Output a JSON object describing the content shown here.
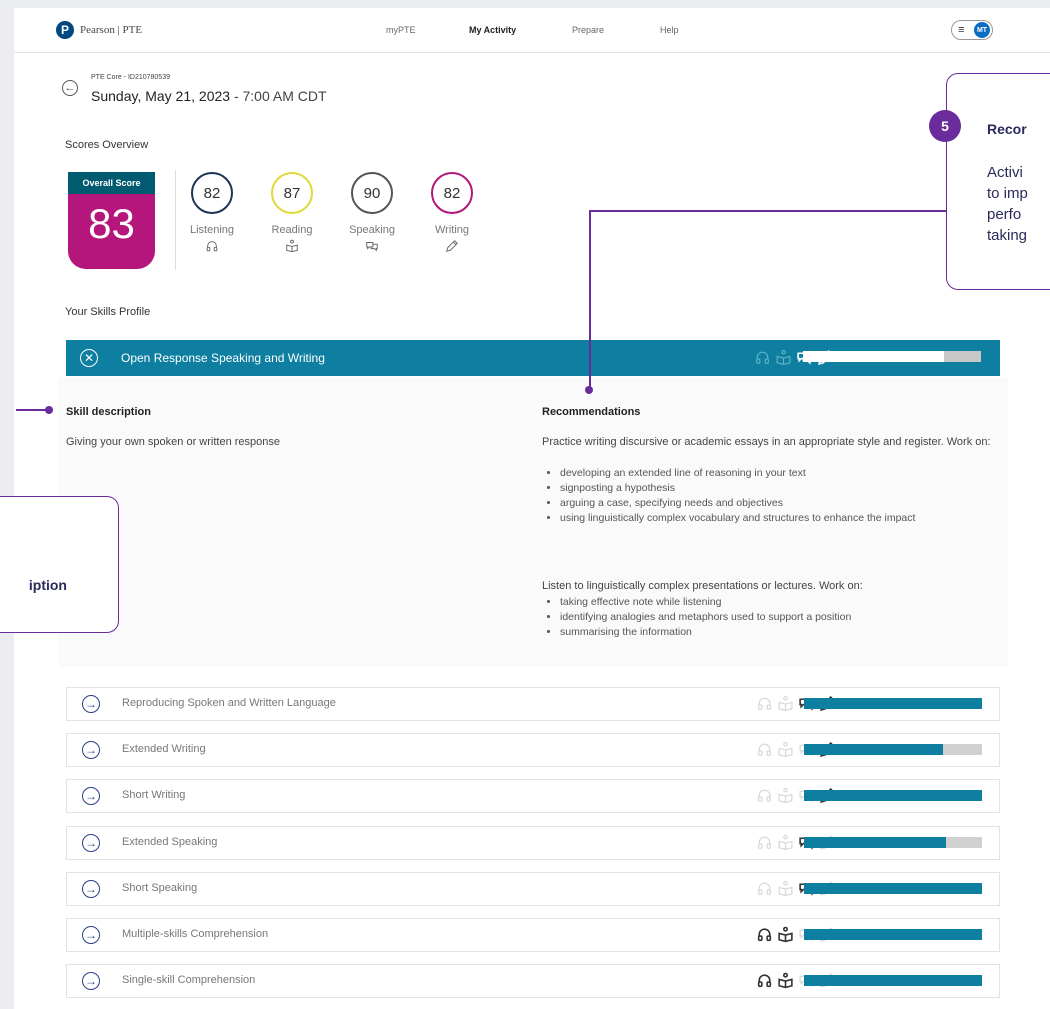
{
  "header": {
    "brand": "Pearson | PTE",
    "nav": [
      {
        "label": "myPTE",
        "active": false
      },
      {
        "label": "My Activity",
        "active": true
      },
      {
        "label": "Prepare",
        "active": false
      },
      {
        "label": "Help",
        "active": false
      }
    ],
    "menu_icon": "hamburger-icon",
    "avatar_initials": "MT"
  },
  "test": {
    "id_line": "PTE Core - ID210780539",
    "date": "Sunday, May 21, 2023",
    "time": " - 7:00 AM CDT"
  },
  "scores_overview": {
    "title": "Scores Overview",
    "overall_label": "Overall Score",
    "overall_value": "83",
    "overall_color": "#b5167c",
    "skills": [
      {
        "label": "Listening",
        "value": "82",
        "color": "#1d3557",
        "icon": "headphones-icon"
      },
      {
        "label": "Reading",
        "value": "87",
        "color": "#e1d83b",
        "icon": "book-icon"
      },
      {
        "label": "Speaking",
        "value": "90",
        "color": "#555555",
        "icon": "speech-bubbles-icon"
      },
      {
        "label": "Writing",
        "value": "82",
        "color": "#b5167c",
        "icon": "pen-icon"
      }
    ]
  },
  "skills_profile": {
    "title": "Your Skills Profile",
    "expanded": {
      "title": "Open Response Speaking and Writing",
      "progress": 0.79,
      "active_skills": [
        false,
        false,
        true,
        true
      ],
      "description_heading": "Skill description",
      "description": "Giving your own spoken or written response",
      "recommendations_heading": "Recommendations",
      "recommendation_groups": [
        {
          "intro": "Practice writing discursive or academic essays in an appropriate style and register. Work on:",
          "items": [
            "developing an extended line of reasoning in your text",
            "signposting a hypothesis",
            "arguing a case, specifying needs and objectives",
            "using linguistically complex vocabulary and structures to enhance the impact"
          ]
        },
        {
          "intro": "Listen to linguistically complex presentations or lectures. Work on:",
          "items": [
            "taking effective note while listening",
            "identifying analogies and metaphors used to support a position",
            "summarising the information"
          ]
        }
      ]
    },
    "rows": [
      {
        "title": "Reproducing Spoken and Written Language",
        "progress": 1.0,
        "active_skills": [
          false,
          false,
          true,
          true
        ]
      },
      {
        "title": "Extended Writing",
        "progress": 0.78,
        "active_skills": [
          false,
          false,
          false,
          true
        ]
      },
      {
        "title": "Short Writing",
        "progress": 1.0,
        "active_skills": [
          false,
          false,
          false,
          true
        ]
      },
      {
        "title": "Extended Speaking",
        "progress": 0.8,
        "active_skills": [
          false,
          false,
          true,
          false
        ]
      },
      {
        "title": "Short Speaking",
        "progress": 1.0,
        "active_skills": [
          false,
          false,
          true,
          false
        ]
      },
      {
        "title": "Multiple-skills Comprehension",
        "progress": 1.0,
        "active_skills": [
          true,
          true,
          false,
          false
        ]
      },
      {
        "title": "Single-skill Comprehension",
        "progress": 1.0,
        "active_skills": [
          true,
          true,
          false,
          false
        ]
      }
    ]
  },
  "callouts": {
    "step_number": "5",
    "right_title": "Recor",
    "right_lines": [
      "Activi",
      "to imp",
      "perfo",
      "taking"
    ],
    "left_title": "iption"
  }
}
